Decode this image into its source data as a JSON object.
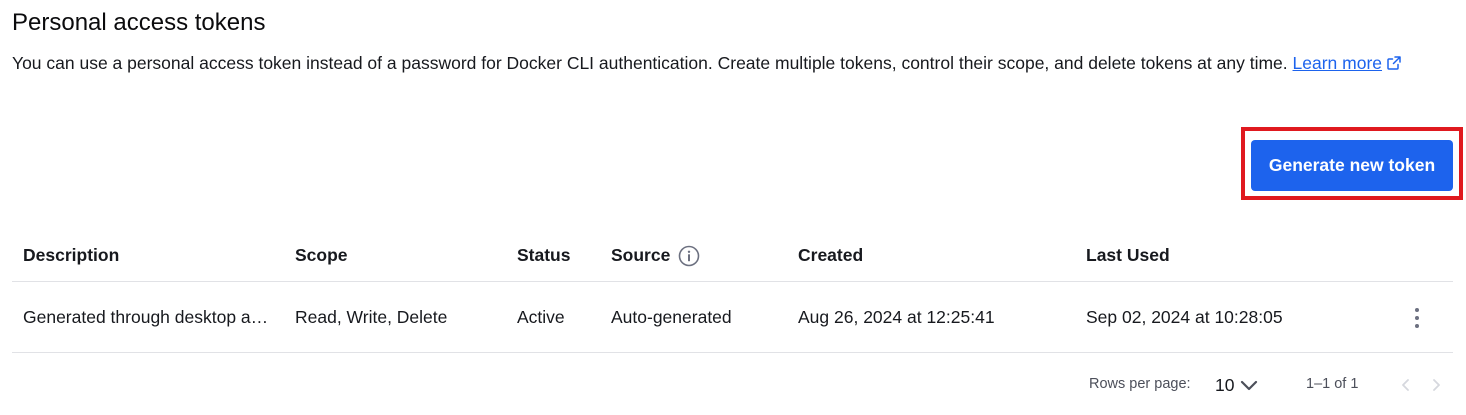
{
  "page": {
    "title": "Personal access tokens",
    "intro_text": "You can use a personal access token instead of a password for Docker CLI authentication. Create multiple tokens, control their scope, and delete tokens at any time.",
    "learn_more_label": "Learn more"
  },
  "actions": {
    "generate_label": "Generate new token",
    "accent_color": "#1d63ed",
    "highlight_color": "#e0191f"
  },
  "table": {
    "columns": [
      "Description",
      "Scope",
      "Status",
      "Source",
      "Created",
      "Last Used"
    ],
    "rows": [
      {
        "description": "Generated through desktop a…",
        "scope": "Read, Write, Delete",
        "status": "Active",
        "source": "Auto-generated",
        "created": "Aug 26, 2024 at 12:25:41",
        "last_used": "Sep 02, 2024 at 10:28:05"
      }
    ]
  },
  "pagination": {
    "rows_per_page_label": "Rows per page:",
    "rows_per_page_value": "10",
    "range_label": "1–1 of 1"
  },
  "icons": {
    "external_link": "external-link-icon",
    "info": "info-icon",
    "more": "more-vertical-icon",
    "chevron_down": "chevron-down-icon",
    "chevron_left": "chevron-left-icon",
    "chevron_right": "chevron-right-icon"
  }
}
